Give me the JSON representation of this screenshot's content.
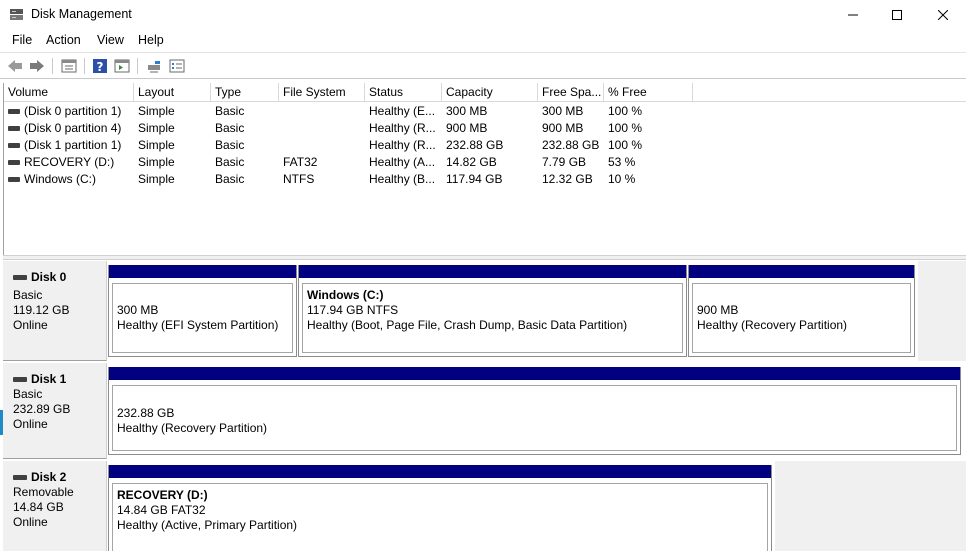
{
  "window": {
    "title": "Disk Management"
  },
  "menu": [
    "File",
    "Action",
    "View",
    "Help"
  ],
  "toolbar": {
    "buttons": [
      "back-icon",
      "forward-icon",
      "properties-icon",
      "help-icon",
      "console-tree-icon",
      "disk-settings-icon",
      "list-view-icon"
    ]
  },
  "volume_list": {
    "columns": [
      "Volume",
      "Layout",
      "Type",
      "File System",
      "Status",
      "Capacity",
      "Free Spa...",
      "% Free"
    ],
    "rows": [
      {
        "volume": "(Disk 0 partition 1)",
        "layout": "Simple",
        "type": "Basic",
        "fs": "",
        "status": "Healthy (E...",
        "capacity": "300 MB",
        "free": "300 MB",
        "pct": "100 %"
      },
      {
        "volume": "(Disk 0 partition 4)",
        "layout": "Simple",
        "type": "Basic",
        "fs": "",
        "status": "Healthy (R...",
        "capacity": "900 MB",
        "free": "900 MB",
        "pct": "100 %"
      },
      {
        "volume": "(Disk 1 partition 1)",
        "layout": "Simple",
        "type": "Basic",
        "fs": "",
        "status": "Healthy (R...",
        "capacity": "232.88 GB",
        "free": "232.88 GB",
        "pct": "100 %"
      },
      {
        "volume": "RECOVERY (D:)",
        "layout": "Simple",
        "type": "Basic",
        "fs": "FAT32",
        "status": "Healthy (A...",
        "capacity": "14.82 GB",
        "free": "7.79 GB",
        "pct": "53 %"
      },
      {
        "volume": "Windows (C:)",
        "layout": "Simple",
        "type": "Basic",
        "fs": "NTFS",
        "status": "Healthy (B...",
        "capacity": "117.94 GB",
        "free": "12.32 GB",
        "pct": "10 %"
      }
    ]
  },
  "disks": [
    {
      "name": "Disk 0",
      "kind": "Basic",
      "size": "119.12 GB",
      "state": "Online",
      "partitions": [
        {
          "title": "",
          "line1": "300 MB",
          "line2": "Healthy (EFI System Partition)"
        },
        {
          "title": "Windows  (C:)",
          "line1": "117.94 GB NTFS",
          "line2": "Healthy (Boot, Page File, Crash Dump, Basic Data Partition)"
        },
        {
          "title": "",
          "line1": "900 MB",
          "line2": "Healthy (Recovery Partition)"
        }
      ]
    },
    {
      "name": "Disk 1",
      "kind": "Basic",
      "size": "232.89 GB",
      "state": "Online",
      "partitions": [
        {
          "title": "",
          "line1": "232.88 GB",
          "line2": "Healthy (Recovery Partition)"
        }
      ]
    },
    {
      "name": "Disk 2",
      "kind": "Removable",
      "size": "14.84 GB",
      "state": "Online",
      "partitions": [
        {
          "title": "RECOVERY  (D:)",
          "line1": "14.84 GB FAT32",
          "line2": "Healthy (Active, Primary Partition)"
        }
      ]
    }
  ],
  "colors": {
    "partition_bar": "#000080",
    "label_bg": "#f0f0f0"
  }
}
